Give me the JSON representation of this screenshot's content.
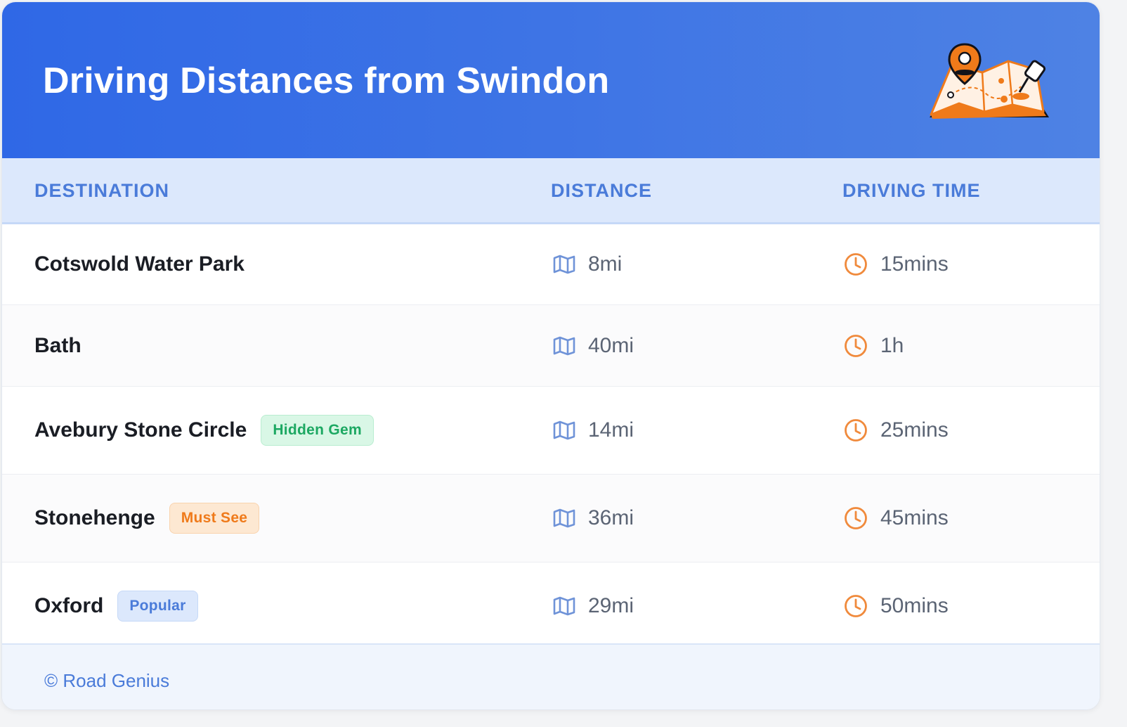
{
  "header": {
    "title": "Driving Distances from Swindon",
    "illustration": "map-with-location-pin-icon"
  },
  "table": {
    "columns": [
      "DESTINATION",
      "DISTANCE",
      "DRIVING TIME"
    ],
    "rows": [
      {
        "destination": "Cotswold Water Park",
        "badge": "",
        "distance": "8mi",
        "time": "15mins"
      },
      {
        "destination": "Bath",
        "badge": "",
        "distance": "40mi",
        "time": "1h"
      },
      {
        "destination": "Avebury Stone Circle",
        "badge": "Hidden Gem",
        "distance": "14mi",
        "time": "25mins"
      },
      {
        "destination": "Stonehenge",
        "badge": "Must See",
        "distance": "36mi",
        "time": "45mins"
      },
      {
        "destination": "Oxford",
        "badge": "Popular",
        "distance": "29mi",
        "time": "50mins"
      }
    ]
  },
  "footer": {
    "copyright": "© Road Genius"
  },
  "colors": {
    "header_bg": "#2f68e6",
    "accent_blue": "#4a7bd9",
    "accent_orange": "#ef7a1a",
    "accent_green": "#1ca862"
  },
  "icons": {
    "distance": "map-icon",
    "time": "clock-icon"
  }
}
